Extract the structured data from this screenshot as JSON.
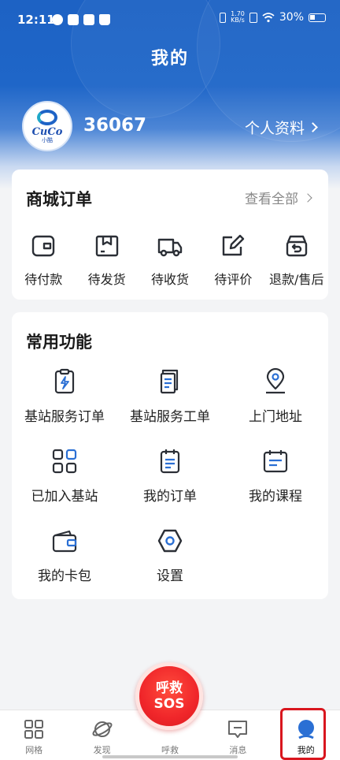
{
  "status": {
    "time": "12:11",
    "speed_value": "1.70",
    "speed_unit": "KB/s",
    "battery": "30%"
  },
  "header": {
    "title": "我的"
  },
  "profile": {
    "logo_text": "CuCo",
    "logo_sub": "小酷",
    "username": "36067",
    "link_label": "个人资料"
  },
  "orders": {
    "title": "商城订单",
    "view_all": "查看全部",
    "items": [
      {
        "label": "待付款",
        "icon": "wallet-icon"
      },
      {
        "label": "待发货",
        "icon": "package-icon"
      },
      {
        "label": "待收货",
        "icon": "truck-icon"
      },
      {
        "label": "待评价",
        "icon": "edit-icon"
      },
      {
        "label": "退款/售后",
        "icon": "return-box-icon"
      }
    ]
  },
  "functions": {
    "title": "常用功能",
    "items": [
      {
        "label": "基站服务订单",
        "icon": "clipboard-bolt-icon"
      },
      {
        "label": "基站服务工单",
        "icon": "documents-icon"
      },
      {
        "label": "上门地址",
        "icon": "location-pin-icon"
      },
      {
        "label": "已加入基站",
        "icon": "grid-icon"
      },
      {
        "label": "我的订单",
        "icon": "clipboard-list-icon"
      },
      {
        "label": "我的课程",
        "icon": "calendar-icon"
      },
      {
        "label": "我的卡包",
        "icon": "card-wallet-icon"
      },
      {
        "label": "设置",
        "icon": "hexagon-settings-icon"
      }
    ]
  },
  "sos": {
    "top": "呼救",
    "bottom": "SOS"
  },
  "tabs": [
    {
      "label": "网格",
      "icon": "grid-icon"
    },
    {
      "label": "发现",
      "icon": "planet-icon"
    },
    {
      "label": "呼救",
      "icon": "none"
    },
    {
      "label": "消息",
      "icon": "message-icon"
    },
    {
      "label": "我的",
      "icon": "user-icon",
      "active": true
    }
  ],
  "colors": {
    "primary": "#1f66c8",
    "icon_stroke": "#2b2f36",
    "accent_blue": "#2a6fd4",
    "sos_red": "#f0262a",
    "highlight": "#d9161e"
  }
}
